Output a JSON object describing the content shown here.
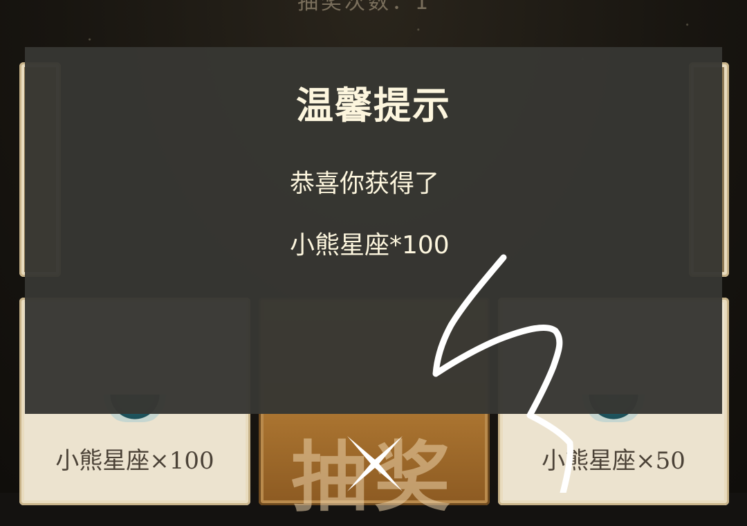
{
  "background": {
    "top_text": "抽奖次数：1"
  },
  "cards": [
    {
      "id": "left",
      "label": "小熊星座×100"
    },
    {
      "id": "middle",
      "label": "抽奖"
    },
    {
      "id": "right",
      "label": "小熊星座×50"
    }
  ],
  "dialog": {
    "title": "温馨提示",
    "message_line1": "恭喜你获得了",
    "message_line2": "小熊星座*100",
    "close_icon": "close-icon"
  },
  "colors": {
    "dialog_bg": "#373733",
    "dialog_text": "#fdf6de",
    "card_bg": "#ece3cf",
    "card_mid_bg": "#a8722f"
  }
}
